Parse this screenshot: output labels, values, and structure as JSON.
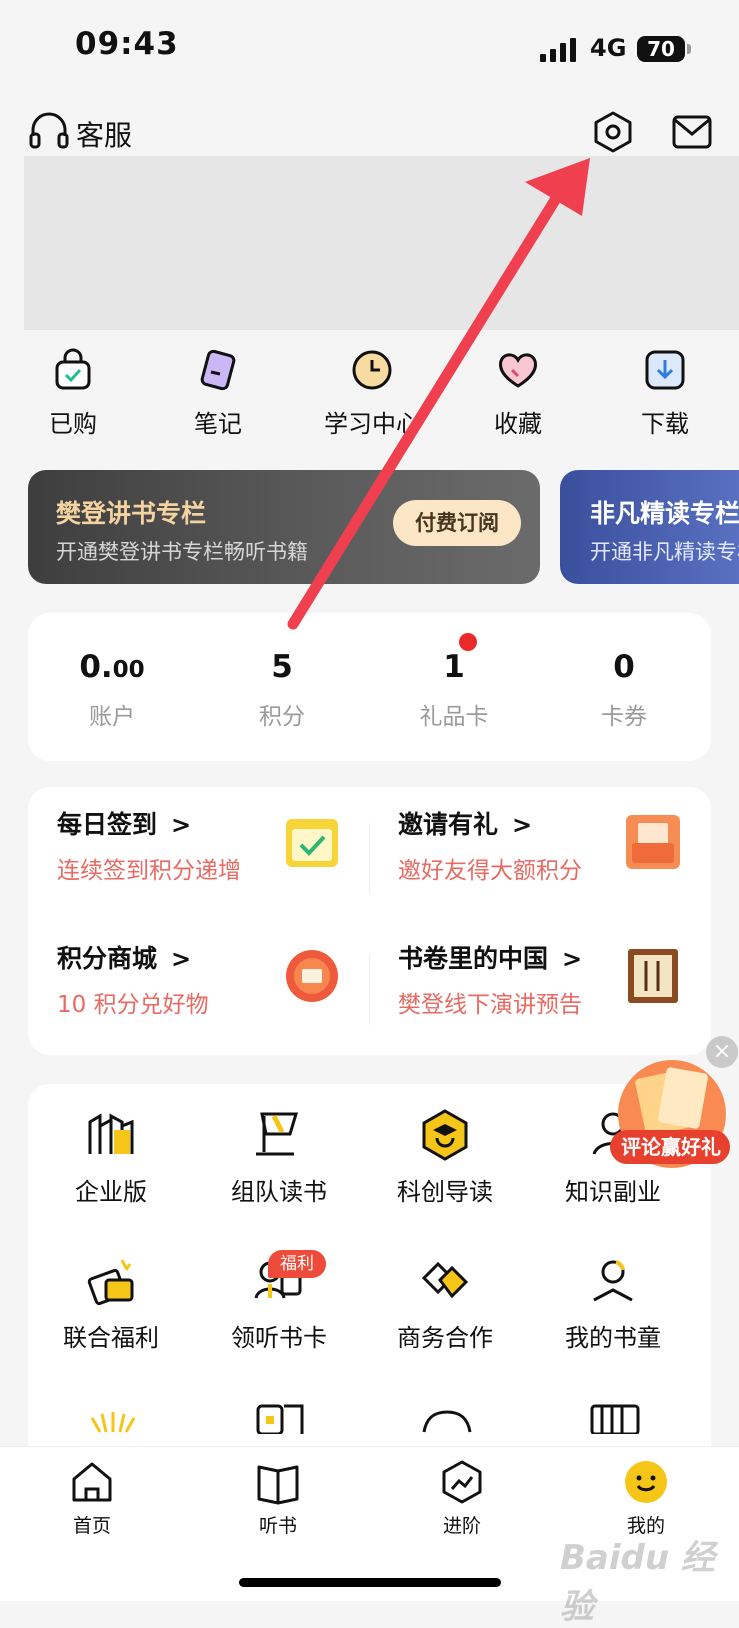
{
  "status": {
    "time": "09:43",
    "network": "4G",
    "battery": "70"
  },
  "header": {
    "service_label": "客服"
  },
  "quick": [
    {
      "label": "已购",
      "icon": "bag-icon"
    },
    {
      "label": "笔记",
      "icon": "note-icon"
    },
    {
      "label": "学习中心",
      "icon": "clock-icon"
    },
    {
      "label": "收藏",
      "icon": "heart-icon"
    },
    {
      "label": "下载",
      "icon": "download-icon"
    }
  ],
  "promos": [
    {
      "title": "樊登讲书专栏",
      "subtitle": "开通樊登讲书专栏畅听书籍",
      "button": "付费订阅"
    },
    {
      "title": "非凡精读专栏",
      "subtitle": "开通非凡精读专栏"
    }
  ],
  "stats": [
    {
      "value": "0.",
      "value_small": "00",
      "label": "账户"
    },
    {
      "value": "5",
      "label": "积分"
    },
    {
      "value": "1",
      "label": "礼品卡"
    },
    {
      "value": "0",
      "label": "卡券"
    }
  ],
  "tasks": [
    {
      "title": "每日签到",
      "subtitle": "连续签到积分递增"
    },
    {
      "title": "邀请有礼",
      "subtitle": "邀好友得大额积分"
    },
    {
      "title": "积分商城",
      "subtitle": "10 积分兑好物"
    },
    {
      "title": "书卷里的中国",
      "subtitle": "樊登线下演讲预告"
    }
  ],
  "features": [
    {
      "label": "企业版",
      "icon": "enterprise-icon"
    },
    {
      "label": "组队读书",
      "icon": "flag-icon"
    },
    {
      "label": "科创导读",
      "icon": "graduate-icon"
    },
    {
      "label": "知识副业",
      "icon": "person-icon"
    },
    {
      "label": "联合福利",
      "icon": "gift-card-icon"
    },
    {
      "label": "领听书卡",
      "icon": "group-icon"
    },
    {
      "label": "商务合作",
      "icon": "handshake-icon"
    },
    {
      "label": "我的书童",
      "icon": "reader-icon"
    }
  ],
  "welfare_badge": "福利",
  "float_promo": "评论赢好礼",
  "chevron": ">",
  "close_symbol": "×",
  "nav": [
    {
      "label": "首页",
      "icon": "home-icon"
    },
    {
      "label": "听书",
      "icon": "book-icon"
    },
    {
      "label": "进阶",
      "icon": "progress-icon"
    },
    {
      "label": "我的",
      "icon": "smile-icon"
    }
  ],
  "watermark": "Baidu 经验",
  "colors": {
    "accent": "#f5c518",
    "arrow": "#f04050",
    "sub_red": "#e86a62"
  }
}
